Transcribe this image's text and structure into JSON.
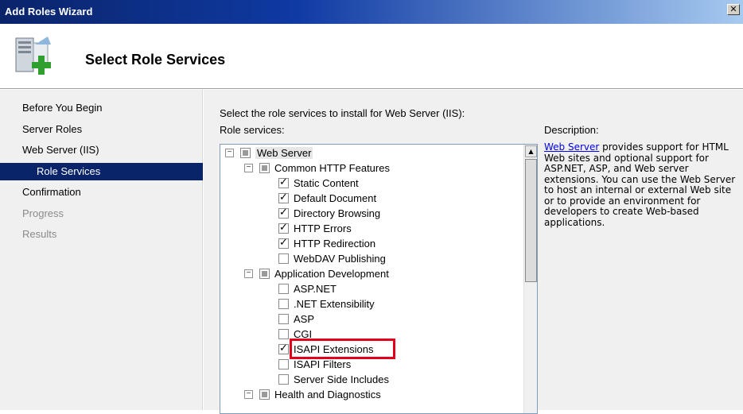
{
  "window": {
    "title": "Add Roles Wizard",
    "close_glyph": "✕"
  },
  "header": {
    "title": "Select Role Services",
    "icon": "server-with-add-icon"
  },
  "nav": {
    "items": [
      {
        "label": "Before You Begin",
        "state": "normal"
      },
      {
        "label": "Server Roles",
        "state": "normal"
      },
      {
        "label": "Web Server (IIS)",
        "state": "normal"
      },
      {
        "label": "Role Services",
        "state": "active"
      },
      {
        "label": "Confirmation",
        "state": "normal"
      },
      {
        "label": "Progress",
        "state": "disabled"
      },
      {
        "label": "Results",
        "state": "disabled"
      }
    ]
  },
  "main": {
    "instruction": "Select the role services to install for Web Server (IIS):",
    "role_services_label": "Role services:",
    "description_label": "Description:",
    "description_link": "Web Server",
    "description_text": " provides support for HTML Web sites and optional support for ASP.NET, ASP, and Web server extensions. You can use the Web Server to host an internal or external Web site or to provide an environment for developers to create Web-based applications."
  },
  "tree": [
    {
      "label": "Web Server",
      "level": 0,
      "expander": "−",
      "state": "partial",
      "selected": true
    },
    {
      "label": "Common HTTP Features",
      "level": 1,
      "expander": "−",
      "state": "partial"
    },
    {
      "label": "Static Content",
      "level": 2,
      "state": "checked"
    },
    {
      "label": "Default Document",
      "level": 2,
      "state": "checked"
    },
    {
      "label": "Directory Browsing",
      "level": 2,
      "state": "checked"
    },
    {
      "label": "HTTP Errors",
      "level": 2,
      "state": "checked"
    },
    {
      "label": "HTTP Redirection",
      "level": 2,
      "state": "checked"
    },
    {
      "label": "WebDAV Publishing",
      "level": 2,
      "state": "unchecked"
    },
    {
      "label": "Application Development",
      "level": 1,
      "expander": "−",
      "state": "partial"
    },
    {
      "label": "ASP.NET",
      "level": 2,
      "state": "unchecked"
    },
    {
      "label": ".NET Extensibility",
      "level": 2,
      "state": "unchecked"
    },
    {
      "label": "ASP",
      "level": 2,
      "state": "unchecked"
    },
    {
      "label": "CGI",
      "level": 2,
      "state": "unchecked"
    },
    {
      "label": "ISAPI Extensions",
      "level": 2,
      "state": "checked",
      "highlighted": true
    },
    {
      "label": "ISAPI Filters",
      "level": 2,
      "state": "unchecked"
    },
    {
      "label": "Server Side Includes",
      "level": 2,
      "state": "unchecked"
    },
    {
      "label": "Health and Diagnostics",
      "level": 1,
      "expander": "−",
      "state": "partial"
    }
  ],
  "colors": {
    "nav_active": "#0a246a",
    "highlight_box": "#e3001b",
    "link": "#0000ee"
  }
}
